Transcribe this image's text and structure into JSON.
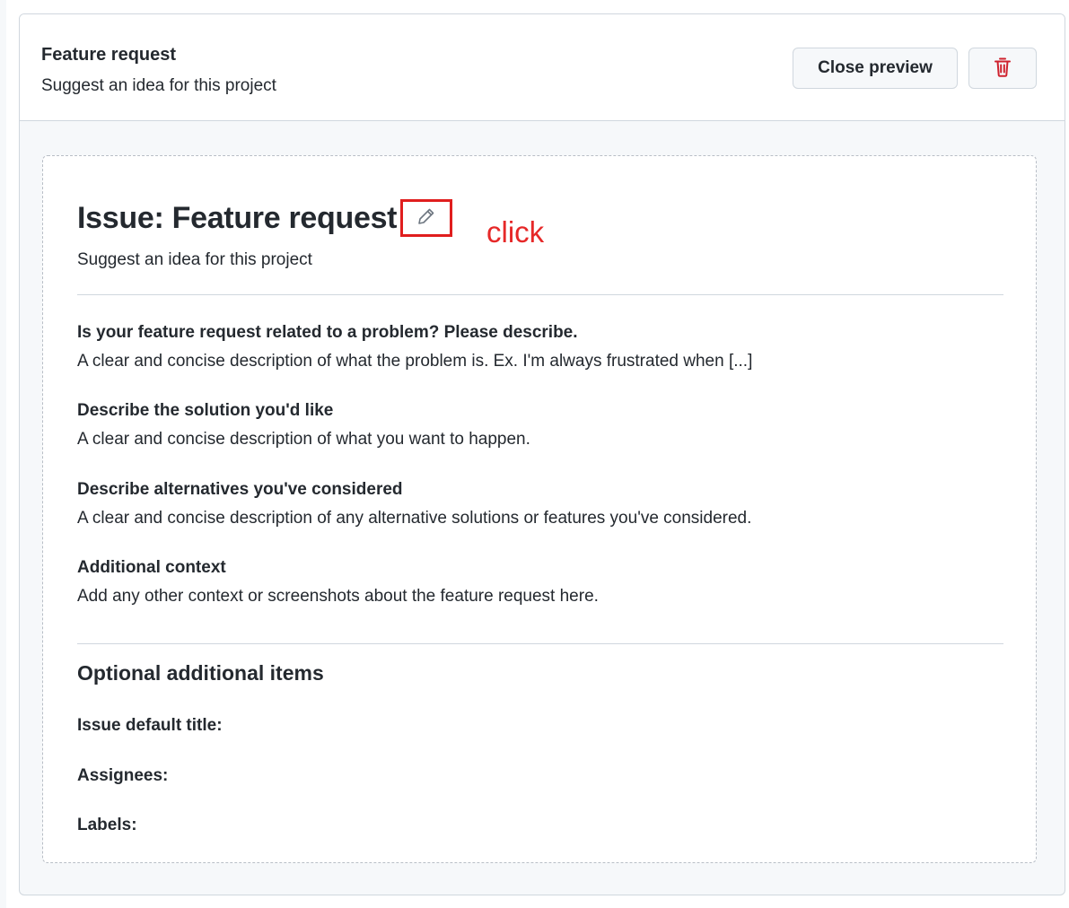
{
  "header": {
    "title": "Feature request",
    "subtitle": "Suggest an idea for this project",
    "close_preview_label": "Close preview",
    "delete_icon": "trash-icon"
  },
  "preview": {
    "issue_title": "Issue: Feature request",
    "edit_icon": "pencil-icon",
    "annotation": "click",
    "issue_subtitle": "Suggest an idea for this project",
    "sections": [
      {
        "title": "Is your feature request related to a problem? Please describe.",
        "body": "A clear and concise description of what the problem is. Ex. I'm always frustrated when [...]"
      },
      {
        "title": "Describe the solution you'd like",
        "body": "A clear and concise description of what you want to happen."
      },
      {
        "title": "Describe alternatives you've considered",
        "body": "A clear and concise description of any alternative solutions or features you've considered."
      },
      {
        "title": "Additional context",
        "body": "Add any other context or screenshots about the feature request here."
      }
    ],
    "optional": {
      "heading": "Optional additional items",
      "default_title_label": "Issue default title:",
      "assignees_label": "Assignees:",
      "labels_label": "Labels:"
    }
  },
  "colors": {
    "annotation_red": "#e62828",
    "delete_red": "#cf222e",
    "border": "#d0d7de"
  }
}
